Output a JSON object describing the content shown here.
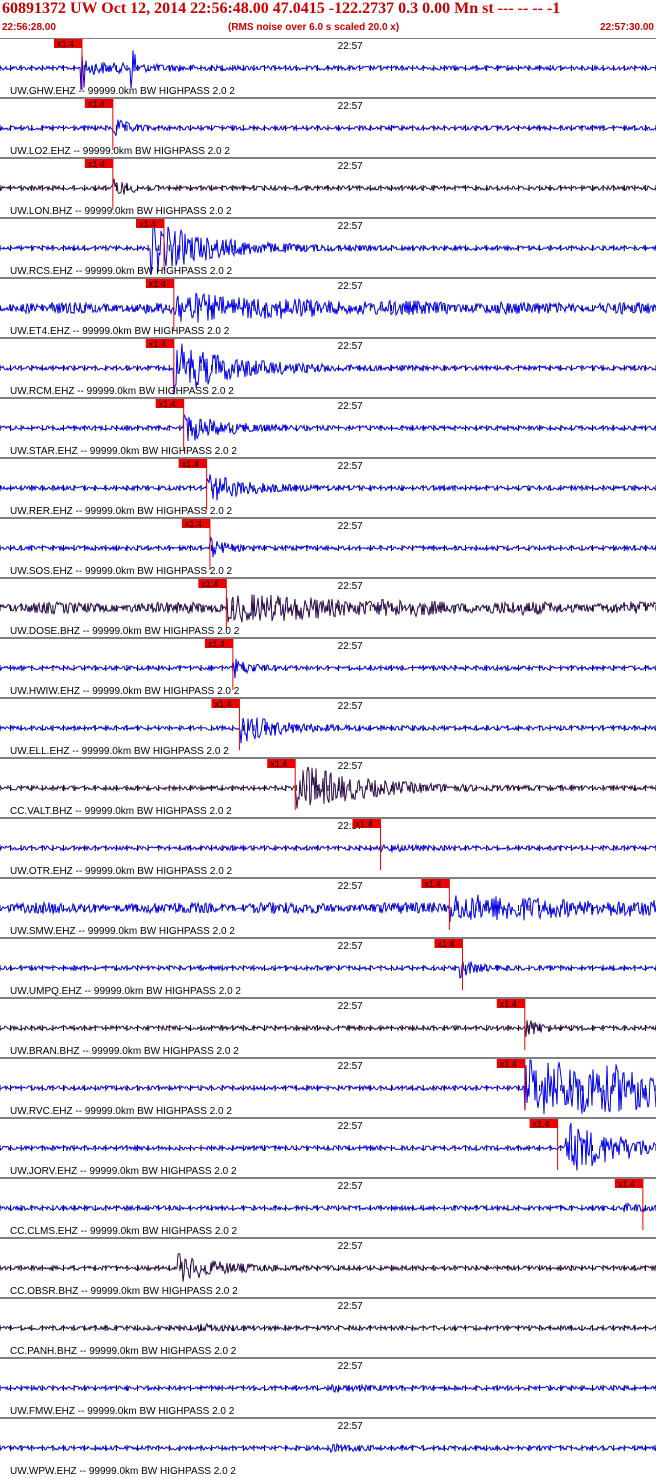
{
  "header": {
    "title": "60891372 UW Oct 12, 2014 22:56:48.00   47.0415 -122.2737  0.3 0.00 Mn st --- -- --  -1",
    "start_time": "22:56:28.00",
    "subtitle": "(RMS noise over 6.0 s scaled 20.0 x)",
    "end_time": "22:57:30.00"
  },
  "time_tick_label": "22:57",
  "pick_label": "x1.4",
  "colors": {
    "blue": "#0000ee",
    "purple": "#2a0a4a",
    "red": "#ee0000",
    "header_text": "#cc0000"
  },
  "traces": [
    {
      "label": "UW.GHW.EHZ -- 99999.0km BW  HIGHPASS  2.0  2",
      "color": "blue",
      "pick": 0.125,
      "tick_x": 0.53,
      "quake": 0.125,
      "env": "spiky"
    },
    {
      "label": "UW.LO2.EHZ -- 99999.0km BW  HIGHPASS  2.0  2",
      "color": "blue",
      "pick": 0.172,
      "tick_x": 0.53,
      "quake": 0.172,
      "env": "small"
    },
    {
      "label": "UW.LON.BHZ -- 99999.0km BW  HIGHPASS  2.0  2",
      "color": "purple",
      "pick": 0.172,
      "tick_x": 0.53,
      "quake": 0.172,
      "env": "small"
    },
    {
      "label": "UW.RCS.EHZ -- 99999.0km BW  HIGHPASS  2.0  2",
      "color": "blue",
      "pick": 0.25,
      "tick_x": 0.53,
      "quake": 0.23,
      "env": "big"
    },
    {
      "label": "UW.ET4.EHZ -- 99999.0km BW  HIGHPASS  2.0  2",
      "color": "blue",
      "pick": 0.265,
      "tick_x": 0.53,
      "quake": 0.265,
      "env": "noisy"
    },
    {
      "label": "UW.RCM.EHZ -- 99999.0km BW  HIGHPASS  2.0  2",
      "color": "blue",
      "pick": 0.265,
      "tick_x": 0.53,
      "quake": 0.265,
      "env": "big"
    },
    {
      "label": "UW.STAR.EHZ -- 99999.0km BW  HIGHPASS  2.0  2",
      "color": "blue",
      "pick": 0.28,
      "tick_x": 0.53,
      "quake": 0.28,
      "env": "medium"
    },
    {
      "label": "UW.RER.EHZ -- 99999.0km BW  HIGHPASS  2.0  2",
      "color": "blue",
      "pick": 0.315,
      "tick_x": 0.53,
      "quake": 0.315,
      "env": "medium"
    },
    {
      "label": "UW.SOS.EHZ -- 99999.0km BW  HIGHPASS  2.0  2",
      "color": "blue",
      "pick": 0.32,
      "tick_x": 0.53,
      "quake": 0.32,
      "env": "small"
    },
    {
      "label": "UW.DOSE.BHZ -- 99999.0km BW  HIGHPASS  2.0  2",
      "color": "purple",
      "pick": 0.345,
      "tick_x": 0.53,
      "quake": 0.345,
      "env": "noisy"
    },
    {
      "label": "UW.HWIW.EHZ -- 99999.0km BW  HIGHPASS  2.0  2",
      "color": "blue",
      "pick": 0.355,
      "tick_x": 0.53,
      "quake": 0.355,
      "env": "small"
    },
    {
      "label": "UW.ELL.EHZ -- 99999.0km BW  HIGHPASS  2.0  2",
      "color": "blue",
      "pick": 0.365,
      "tick_x": 0.53,
      "quake": 0.365,
      "env": "medium"
    },
    {
      "label": "CC.VALT.BHZ -- 99999.0km BW  HIGHPASS  2.0  2",
      "color": "purple",
      "pick": 0.45,
      "tick_x": 0.53,
      "quake": 0.45,
      "env": "big"
    },
    {
      "label": "UW.OTR.EHZ -- 99999.0km BW  HIGHPASS  2.0  2",
      "color": "blue",
      "pick": 0.58,
      "tick_x": 0.53,
      "quake": 0.58,
      "env": "flat"
    },
    {
      "label": "UW.SMW.EHZ -- 99999.0km BW  HIGHPASS  2.0  2",
      "color": "blue",
      "pick": 0.685,
      "tick_x": 0.53,
      "quake": 0.685,
      "env": "noisy"
    },
    {
      "label": "UW.UMPQ.EHZ -- 99999.0km BW  HIGHPASS  2.0  2",
      "color": "blue",
      "pick": 0.705,
      "tick_x": 0.53,
      "quake": 0.7,
      "env": "small"
    },
    {
      "label": "UW.BRAN.BHZ -- 99999.0km BW  HIGHPASS  2.0  2",
      "color": "purple",
      "pick": 0.8,
      "tick_x": 0.53,
      "quake": 0.8,
      "env": "small"
    },
    {
      "label": "UW.RVC.EHZ -- 99999.0km BW  HIGHPASS  2.0  2",
      "color": "blue",
      "pick": 0.8,
      "tick_x": 0.53,
      "quake": 0.8,
      "env": "clip"
    },
    {
      "label": "UW.JORV.EHZ -- 99999.0km BW  HIGHPASS  2.0  2",
      "color": "blue",
      "pick": 0.85,
      "tick_x": 0.53,
      "quake": 0.86,
      "env": "big"
    },
    {
      "label": "CC.CLMS.EHZ -- 99999.0km BW  HIGHPASS  2.0  2",
      "color": "blue",
      "pick": 0.98,
      "tick_x": 0.53,
      "quake": 0.95,
      "env": "flat"
    },
    {
      "label": "CC.OBSR.BHZ -- 99999.0km BW  HIGHPASS  2.0  2",
      "color": "purple",
      "pick": null,
      "tick_x": 0.53,
      "quake": 0.27,
      "env": "medium"
    },
    {
      "label": "CC.PANH.BHZ -- 99999.0km BW  HIGHPASS  2.0  2",
      "color": "purple",
      "pick": null,
      "tick_x": 0.53,
      "quake": 0.3,
      "env": "flat"
    },
    {
      "label": "UW.FMW.EHZ -- 99999.0km BW  HIGHPASS  2.0  2",
      "color": "blue",
      "pick": null,
      "tick_x": 0.53,
      "quake": 0.5,
      "env": "flat"
    },
    {
      "label": "UW.WPW.EHZ -- 99999.0km BW  HIGHPASS  2.0  2",
      "color": "blue",
      "pick": null,
      "tick_x": 0.53,
      "quake": 0.5,
      "env": "flat"
    }
  ]
}
